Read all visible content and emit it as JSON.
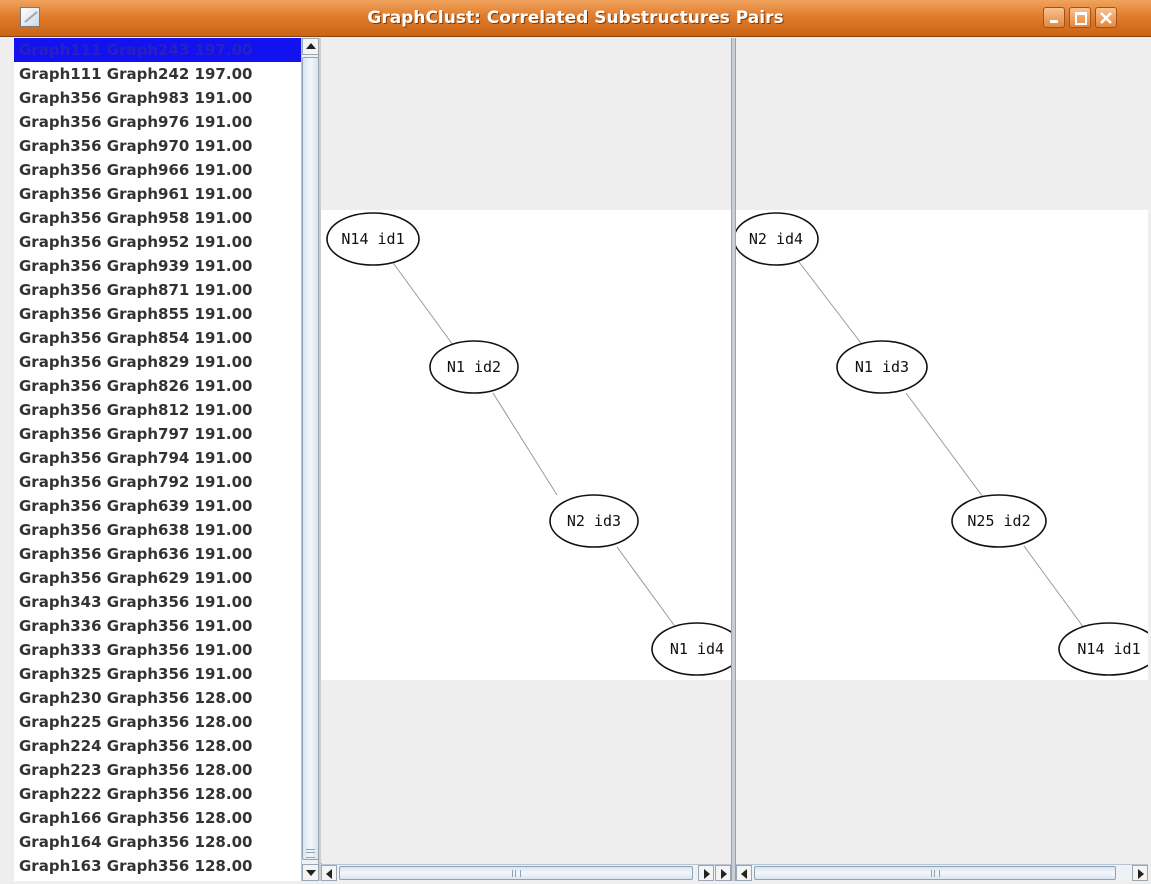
{
  "window": {
    "title": "GraphClust: Correlated Substructures Pairs"
  },
  "list": {
    "selected_index": 0,
    "items": [
      {
        "label": "Graph111 Graph243 197.00"
      },
      {
        "label": "Graph111 Graph242 197.00"
      },
      {
        "label": "Graph356 Graph983 191.00"
      },
      {
        "label": "Graph356 Graph976 191.00"
      },
      {
        "label": "Graph356 Graph970 191.00"
      },
      {
        "label": "Graph356 Graph966 191.00"
      },
      {
        "label": "Graph356 Graph961 191.00"
      },
      {
        "label": "Graph356 Graph958 191.00"
      },
      {
        "label": "Graph356 Graph952 191.00"
      },
      {
        "label": "Graph356 Graph939 191.00"
      },
      {
        "label": "Graph356 Graph871 191.00"
      },
      {
        "label": "Graph356 Graph855 191.00"
      },
      {
        "label": "Graph356 Graph854 191.00"
      },
      {
        "label": "Graph356 Graph829 191.00"
      },
      {
        "label": "Graph356 Graph826 191.00"
      },
      {
        "label": "Graph356 Graph812 191.00"
      },
      {
        "label": "Graph356 Graph797 191.00"
      },
      {
        "label": "Graph356 Graph794 191.00"
      },
      {
        "label": "Graph356 Graph792 191.00"
      },
      {
        "label": "Graph356 Graph639 191.00"
      },
      {
        "label": "Graph356 Graph638 191.00"
      },
      {
        "label": "Graph356 Graph636 191.00"
      },
      {
        "label": "Graph356 Graph629 191.00"
      },
      {
        "label": "Graph343 Graph356 191.00"
      },
      {
        "label": "Graph336 Graph356 191.00"
      },
      {
        "label": "Graph333 Graph356 191.00"
      },
      {
        "label": "Graph325 Graph356 191.00"
      },
      {
        "label": "Graph230 Graph356 128.00"
      },
      {
        "label": "Graph225 Graph356 128.00"
      },
      {
        "label": "Graph224 Graph356 128.00"
      },
      {
        "label": "Graph223 Graph356 128.00"
      },
      {
        "label": "Graph222 Graph356 128.00"
      },
      {
        "label": "Graph166 Graph356 128.00"
      },
      {
        "label": "Graph164 Graph356 128.00"
      },
      {
        "label": "Graph163 Graph356 128.00"
      }
    ]
  },
  "graphs": {
    "left": {
      "nodes": [
        "N14 id1",
        "N1 id2",
        "N2 id3",
        "N1 id4"
      ]
    },
    "right": {
      "nodes": [
        "N2 id4",
        "N1 id3",
        "N25 id2",
        "N14 id1"
      ]
    }
  },
  "colors": {
    "titlebar": "#e07c2c",
    "selection": "#1212f0"
  }
}
